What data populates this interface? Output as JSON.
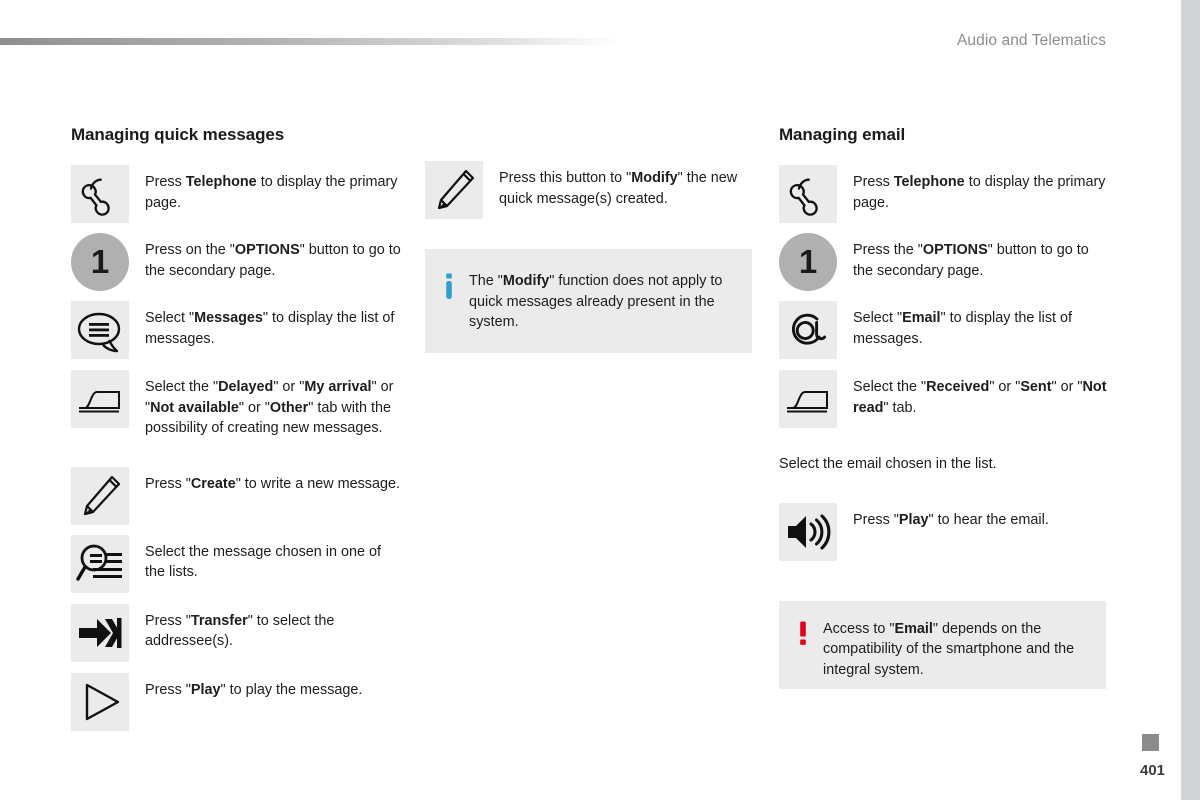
{
  "header": {
    "title": "Audio and Telematics"
  },
  "footer": {
    "page_number": "401"
  },
  "columns": {
    "left": {
      "title": "Managing quick messages",
      "steps": [
        {
          "icon": "telephone-handset-icon",
          "text_html": "Press <b>Telephone</b> to display the primary page."
        },
        {
          "icon": "numbered-circle-1-icon",
          "text_html": "Press on the \"<b>OPTIONS</b>\" button to go to the secondary page."
        },
        {
          "icon": "message-bubble-icon",
          "text_html": "Select \"<b>Messages</b>\" to display the list of messages."
        },
        {
          "icon": "tab-icon",
          "text_html": "Select the \"<b>Delayed</b>\" or \"<b>My arrival</b>\" or \"<b>Not available</b>\" or \"<b>Other</b>\" tab with the possibility of creating new messages."
        },
        {
          "icon": "pencil-icon",
          "text_html": "Press \"<b>Create</b>\" to write a new message."
        },
        {
          "icon": "magnifier-list-icon",
          "text_html": "Select the message chosen in one of the lists."
        },
        {
          "icon": "transfer-arrow-icon",
          "text_html": "Press \"<b>Transfer</b>\" to select the addressee(s)."
        },
        {
          "icon": "play-triangle-icon",
          "text_html": "Press \"<b>Play</b>\" to play the message."
        }
      ]
    },
    "middle": {
      "steps": [
        {
          "icon": "pencil-icon",
          "text_html": "Press this button to \"<b>Modify</b>\" the new quick message(s) created."
        }
      ],
      "note": {
        "icon": "info-icon",
        "icon_color": "#2f9fd0",
        "text_html": "The \"<b>Modify</b>\" function does not apply to quick messages already present in the system."
      }
    },
    "right": {
      "title": "Managing email",
      "steps": [
        {
          "icon": "telephone-handset-icon",
          "text_html": "Press <b>Telephone</b> to display the primary page."
        },
        {
          "icon": "numbered-circle-1-icon",
          "text_html": "Press the \"<b>OPTIONS</b>\" button to go to the secondary page."
        },
        {
          "icon": "at-sign-icon",
          "text_html": "Select \"<b>Email</b>\" to display the list of messages."
        },
        {
          "icon": "tab-icon",
          "text_html": "Select the \"<b>Received</b>\" or \"<b>Sent</b>\" or \"<b>Not read</b>\" tab."
        }
      ],
      "standalone_text": "Select the email chosen in the list.",
      "steps_after": [
        {
          "icon": "speaker-icon",
          "text_html": "Press \"<b>Play</b>\" to hear the email."
        }
      ],
      "warning": {
        "icon": "exclamation-icon",
        "icon_color": "#e2001a",
        "text_html": "Access to \"<b>Email</b>\" depends on the compatibility of the smartphone and the integral system."
      }
    }
  },
  "numbered_circle_label": "1"
}
